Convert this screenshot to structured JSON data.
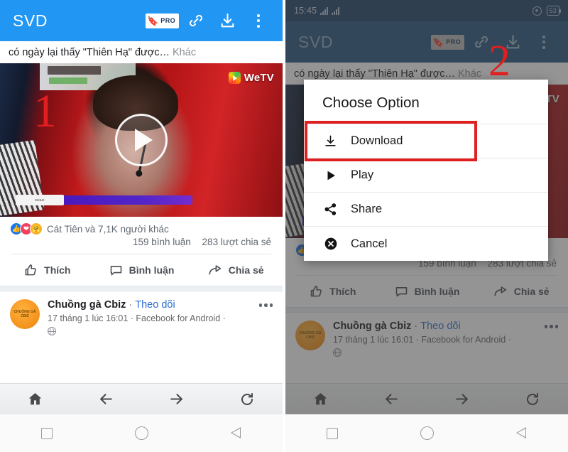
{
  "statusbar": {
    "time": "15:45",
    "signal_icon": "signal-bars-icon",
    "signal_icon_2": "signal-bars-icon",
    "mute_icon": "circle-lock-icon",
    "battery_level": "53"
  },
  "appbar": {
    "brand": "SVD",
    "pro_badge_label": "PRO",
    "pro_badge_icon": "bookmark-star-icon",
    "link_icon": "chain-link-icon",
    "download_icon": "download-arrow-icon",
    "overflow_icon": "three-dots-vertical-icon"
  },
  "post": {
    "caption_text": "có ngày lại thấy \"Thiên Hạ\" được…",
    "caption_more": "Khác",
    "video": {
      "watermark": "WeTV",
      "watermark_icon": "wetv-logo-icon",
      "play_icon": "play-button-icon",
      "progress_label": "CHILE"
    },
    "reactions": {
      "like_icon": "thumbs-up-reaction-icon",
      "love_icon": "heart-reaction-icon",
      "care_icon": "care-reaction-icon",
      "summary": "Cát Tiên và 7,1K người khác",
      "comments": "159 bình luận",
      "shares": "283 lượt chia sẻ"
    },
    "actions": [
      {
        "label": "Thích",
        "icon": "thumbs-up-icon"
      },
      {
        "label": "Bình luận",
        "icon": "comment-bubble-icon"
      },
      {
        "label": "Chia sẻ",
        "icon": "share-arrow-icon"
      }
    ]
  },
  "next_post": {
    "avatar_text": "CHUỒNG GÀ CBIZ",
    "page_name": "Chuồng gà Cbiz",
    "separator": "·",
    "follow_label": "Theo dõi",
    "timestamp": "17 tháng 1 lúc 16:01 · Facebook for Android ·",
    "privacy_icon": "globe-icon",
    "overflow_icon": "three-dots-horizontal-icon"
  },
  "browser_nav": [
    {
      "name": "home",
      "icon": "home-icon"
    },
    {
      "name": "back",
      "icon": "arrow-left-icon"
    },
    {
      "name": "forward",
      "icon": "arrow-right-icon"
    },
    {
      "name": "reload",
      "icon": "reload-icon"
    }
  ],
  "android_nav": [
    {
      "name": "recents",
      "icon": "square-icon"
    },
    {
      "name": "home",
      "icon": "circle-icon"
    },
    {
      "name": "back",
      "icon": "triangle-back-icon"
    }
  ],
  "dialog": {
    "title": "Choose Option",
    "items": [
      {
        "label": "Download",
        "icon": "download-arrow-icon",
        "highlighted": true
      },
      {
        "label": "Play",
        "icon": "play-triangle-icon",
        "highlighted": false
      },
      {
        "label": "Share",
        "icon": "share-nodes-icon",
        "highlighted": false
      },
      {
        "label": "Cancel",
        "icon": "close-circle-icon",
        "highlighted": false
      }
    ]
  },
  "annotations": {
    "step_one": "1",
    "step_two": "2",
    "color": "#e02020"
  },
  "colors": {
    "appbar_blue": "#2196f3",
    "appbar_blue_dim": "#27557f",
    "statusbar": "#1f4368",
    "link_blue": "#2d6fd0",
    "annotation_red": "#e02020"
  }
}
